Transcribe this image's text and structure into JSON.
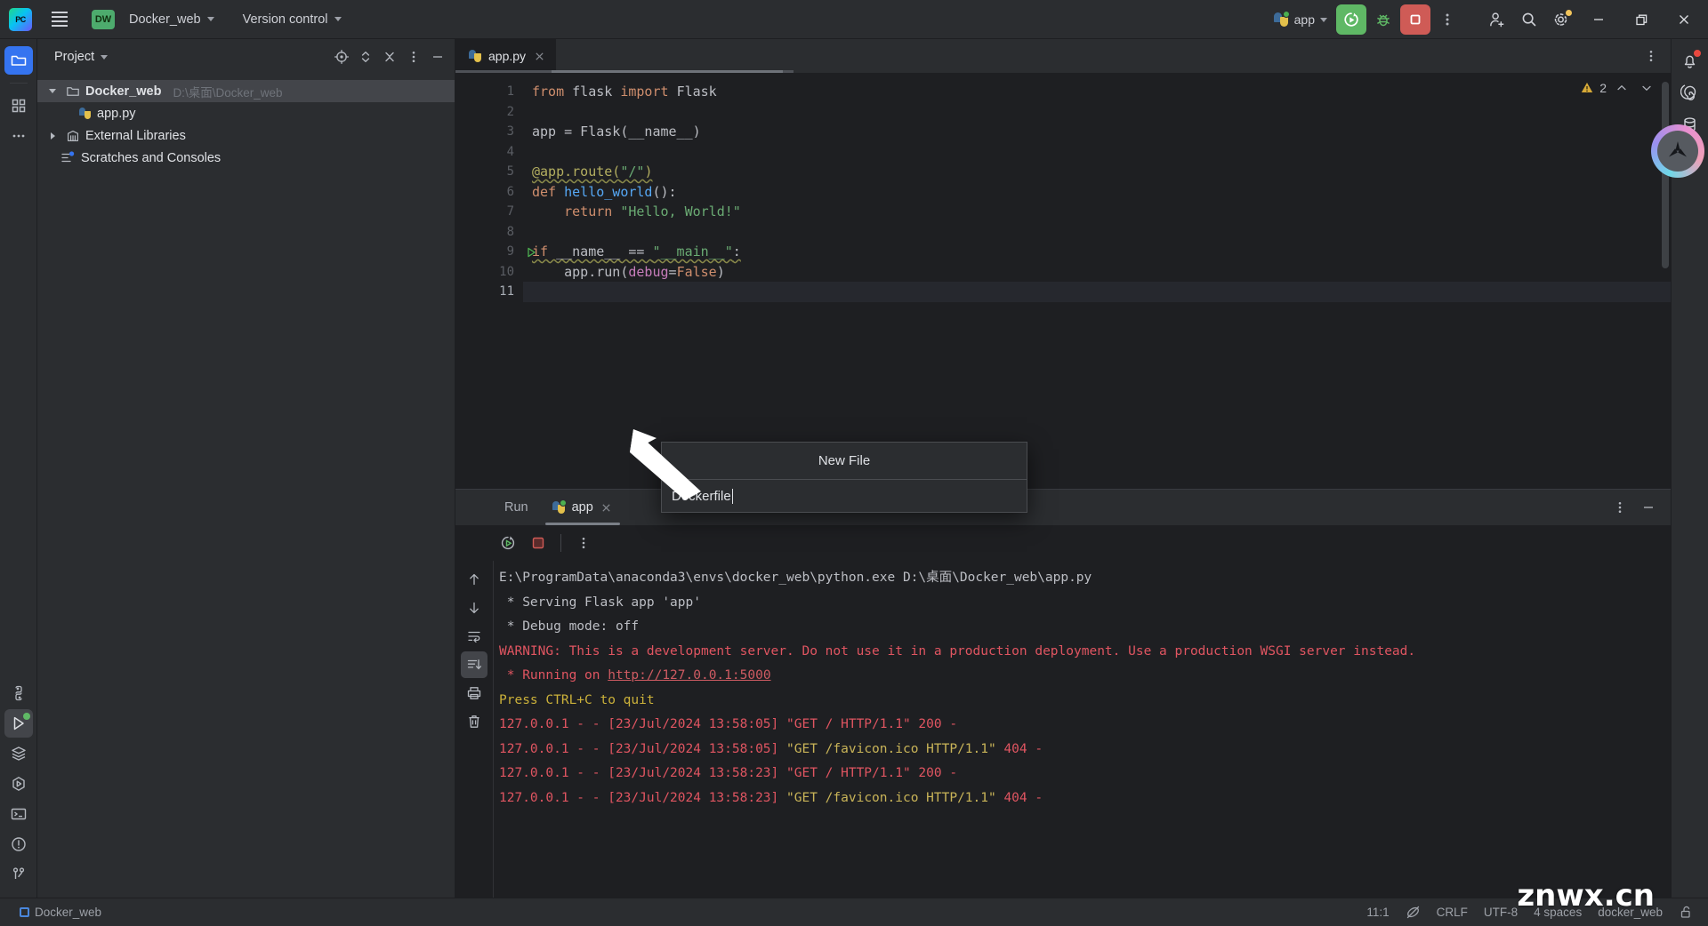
{
  "titlebar": {
    "app_icon": "pycharm-logo-icon",
    "app_icon_text": "PC",
    "menu_icon": "hamburger-menu-icon",
    "project_badge": "DW",
    "project_name": "Docker_web",
    "version_control": "Version control",
    "run_config_name": "app",
    "run_icon": "run-icon",
    "debug_icon": "debug-bug-icon",
    "stop_icon": "stop-icon",
    "more_icon": "more-vertical-icon",
    "account_icon": "add-user-icon",
    "search_icon": "search-icon",
    "settings_icon": "gear-icon",
    "minimize_icon": "minimize-icon",
    "maximize_icon": "maximize-restore-icon",
    "close_icon": "close-icon"
  },
  "left_strip": {
    "items": [
      {
        "name": "project-tool-window",
        "icon": "folder-icon",
        "active": true
      },
      {
        "name": "commit-tool-window",
        "icon": "commit-grid-icon",
        "active": false
      },
      {
        "name": "more-tool-windows",
        "icon": "ellipsis-icon",
        "active": false
      }
    ],
    "bottom_items": [
      {
        "name": "python-packages",
        "icon": "python-icon",
        "active": false
      },
      {
        "name": "run-tool-window",
        "icon": "run-play-icon",
        "active": true
      },
      {
        "name": "services-tool-window",
        "icon": "layers-icon",
        "active": false
      },
      {
        "name": "python-console",
        "icon": "python-console-icon",
        "active": false
      },
      {
        "name": "terminal-tool-window",
        "icon": "terminal-icon",
        "active": false
      },
      {
        "name": "problems-tool-window",
        "icon": "problems-circle-icon",
        "active": false
      },
      {
        "name": "version-control-window",
        "icon": "git-branch-icon",
        "active": false
      }
    ]
  },
  "project_panel": {
    "title": "Project",
    "actions": [
      {
        "name": "select-opened-file",
        "icon": "target-icon"
      },
      {
        "name": "expand-collapse",
        "icon": "updown-chevrons-icon"
      },
      {
        "name": "collapse-all",
        "icon": "collapse-x-icon"
      },
      {
        "name": "options-menu",
        "icon": "more-vertical-icon"
      },
      {
        "name": "hide-panel",
        "icon": "minimize-icon"
      }
    ],
    "tree": [
      {
        "label": "Docker_web",
        "sub": "D:\\桌面\\Docker_web",
        "icon": "folder-icon",
        "indent": 0,
        "expanded": true,
        "selected": true,
        "bold": true
      },
      {
        "label": "app.py",
        "sub": "",
        "icon": "python-file-icon",
        "indent": 1,
        "expanded": null,
        "selected": false,
        "bold": false
      },
      {
        "label": "External Libraries",
        "sub": "",
        "icon": "library-icon",
        "indent": 0,
        "expanded": false,
        "selected": false,
        "bold": false
      },
      {
        "label": "Scratches and Consoles",
        "sub": "",
        "icon": "scratches-icon",
        "indent": 0,
        "expanded": null,
        "selected": false,
        "bold": false
      }
    ]
  },
  "editor": {
    "tab": {
      "label": "app.py",
      "icon": "python-file-icon",
      "close_icon": "close-icon"
    },
    "more_icon": "more-vertical-icon",
    "warning_count": "2",
    "warning_icon": "warning-triangle-icon",
    "prev_icon": "chevron-up-icon",
    "next_icon": "chevron-down-icon",
    "line_numbers": [
      "1",
      "2",
      "3",
      "4",
      "5",
      "6",
      "7",
      "8",
      "9",
      "10",
      "11"
    ],
    "current_line": 11,
    "run_gutter_line": 9,
    "code_lines": [
      {
        "n": 1,
        "tokens": [
          {
            "t": "from ",
            "c": "kw"
          },
          {
            "t": "flask ",
            "c": "plain"
          },
          {
            "t": "import ",
            "c": "kw"
          },
          {
            "t": "Flask",
            "c": "plain"
          }
        ]
      },
      {
        "n": 2,
        "tokens": []
      },
      {
        "n": 3,
        "tokens": [
          {
            "t": "app = Flask(__name__)",
            "c": "plain"
          }
        ]
      },
      {
        "n": 4,
        "tokens": []
      },
      {
        "n": 5,
        "tokens": [
          {
            "t": "@app.route(",
            "c": "deco"
          },
          {
            "t": "\"/\"",
            "c": "str"
          },
          {
            "t": ")",
            "c": "deco"
          }
        ]
      },
      {
        "n": 6,
        "tokens": [
          {
            "t": "def ",
            "c": "kw"
          },
          {
            "t": "hello_world",
            "c": "fn"
          },
          {
            "t": "():",
            "c": "plain"
          }
        ]
      },
      {
        "n": 7,
        "tokens": [
          {
            "t": "    return ",
            "c": "kw"
          },
          {
            "t": "\"Hello, World!\"",
            "c": "str"
          }
        ]
      },
      {
        "n": 8,
        "tokens": []
      },
      {
        "n": 9,
        "tokens": [
          {
            "t": "if ",
            "c": "kw"
          },
          {
            "t": "__name__ == ",
            "c": "plain"
          },
          {
            "t": "\"__main__\"",
            "c": "str"
          },
          {
            "t": ":",
            "c": "plain"
          }
        ]
      },
      {
        "n": 10,
        "tokens": [
          {
            "t": "    app.run(",
            "c": "plain"
          },
          {
            "t": "debug",
            "c": "param"
          },
          {
            "t": "=",
            "c": "plain"
          },
          {
            "t": "False",
            "c": "kw"
          },
          {
            "t": ")",
            "c": "plain"
          }
        ]
      },
      {
        "n": 11,
        "tokens": []
      }
    ]
  },
  "new_file_popup": {
    "title": "New File",
    "value": "Dockerfile"
  },
  "run_panel": {
    "tabs": [
      {
        "label": "Run",
        "icon": "",
        "active": false,
        "closable": false
      },
      {
        "label": "app",
        "icon": "python-icon",
        "active": true,
        "closable": true
      }
    ],
    "tabs_right": [
      {
        "name": "run-options-menu",
        "icon": "more-vertical-icon"
      },
      {
        "name": "hide-run-panel",
        "icon": "minimize-icon"
      }
    ],
    "top_toolbar": [
      {
        "name": "rerun-button",
        "icon": "rerun-icon"
      },
      {
        "name": "stop-button",
        "icon": "stop-square-icon"
      },
      {
        "name": "run-more-menu",
        "icon": "more-vertical-icon"
      }
    ],
    "side_toolbar": [
      {
        "name": "scroll-up-button",
        "icon": "arrow-up-icon",
        "selected": false
      },
      {
        "name": "scroll-down-button",
        "icon": "arrow-down-icon",
        "selected": false
      },
      {
        "name": "soft-wrap-button",
        "icon": "soft-wrap-icon",
        "selected": false
      },
      {
        "name": "scroll-to-end-button",
        "icon": "scroll-to-end-icon",
        "selected": true
      },
      {
        "name": "print-button",
        "icon": "print-icon",
        "selected": false
      },
      {
        "name": "clear-all-button",
        "icon": "trash-icon",
        "selected": false
      }
    ],
    "console_lines": [
      {
        "segments": [
          {
            "t": "E:\\ProgramData\\anaconda3\\envs\\docker_web\\python.exe D:\\桌面\\Docker_web\\app.py",
            "c": "c-white"
          }
        ]
      },
      {
        "segments": [
          {
            "t": " * Serving Flask app 'app'",
            "c": "c-white"
          }
        ]
      },
      {
        "segments": [
          {
            "t": " * Debug mode: off",
            "c": "c-white"
          }
        ]
      },
      {
        "segments": [
          {
            "t": "WARNING: This is a development server. Do not use it in a production deployment. Use a production WSGI server instead.",
            "c": "c-red"
          }
        ]
      },
      {
        "segments": [
          {
            "t": " * Running on ",
            "c": "c-pink"
          },
          {
            "t": "http://127.0.0.1:5000",
            "c": "c-link"
          }
        ]
      },
      {
        "segments": [
          {
            "t": "Press CTRL+C to quit",
            "c": "c-yellow"
          }
        ]
      },
      {
        "segments": [
          {
            "t": "127.0.0.1 - - [23/Jul/2024 13:58:05] \"GET / HTTP/1.1\" 200 -",
            "c": "c-pink"
          }
        ]
      },
      {
        "segments": [
          {
            "t": "127.0.0.1 - - [23/Jul/2024 13:58:05] ",
            "c": "c-pink"
          },
          {
            "t": "\"GET /favicon.ico HTTP/1.1\" ",
            "c": "c-gold"
          },
          {
            "t": "404 -",
            "c": "c-pink"
          }
        ]
      },
      {
        "segments": [
          {
            "t": "127.0.0.1 - - [23/Jul/2024 13:58:23] \"GET / HTTP/1.1\" 200 -",
            "c": "c-pink"
          }
        ]
      },
      {
        "segments": [
          {
            "t": "127.0.0.1 - - [23/Jul/2024 13:58:23] ",
            "c": "c-pink"
          },
          {
            "t": "\"GET /favicon.ico HTTP/1.1\" ",
            "c": "c-gold"
          },
          {
            "t": "404 -",
            "c": "c-pink"
          }
        ]
      }
    ]
  },
  "right_strip": {
    "items": [
      {
        "name": "notifications",
        "icon": "bell-icon",
        "badge": true
      },
      {
        "name": "ai-assistant",
        "icon": "spiral-icon",
        "badge": false
      },
      {
        "name": "database-tool-window",
        "icon": "database-icon",
        "badge": false
      }
    ]
  },
  "statusbar": {
    "left_label": "Docker_web",
    "left_icon": "project-square-icon",
    "caret_position": "11:1",
    "inspection_icon": "inspection-off-icon",
    "line_separator": "CRLF",
    "encoding": "UTF-8",
    "indent": "4 spaces",
    "interpreter": "docker_web",
    "lock_icon": "unlocked-icon"
  },
  "watermark": "znwx.cn",
  "colors": {
    "bg": "#1e1f22",
    "panel": "#2b2d30",
    "accent_blue": "#3574f0",
    "run_green": "#5fb865",
    "stop_red": "#cf5b56",
    "string_green": "#6aab73",
    "keyword_orange": "#cf8e6d",
    "console_red": "#e05561",
    "console_yellow": "#cbb13a"
  }
}
